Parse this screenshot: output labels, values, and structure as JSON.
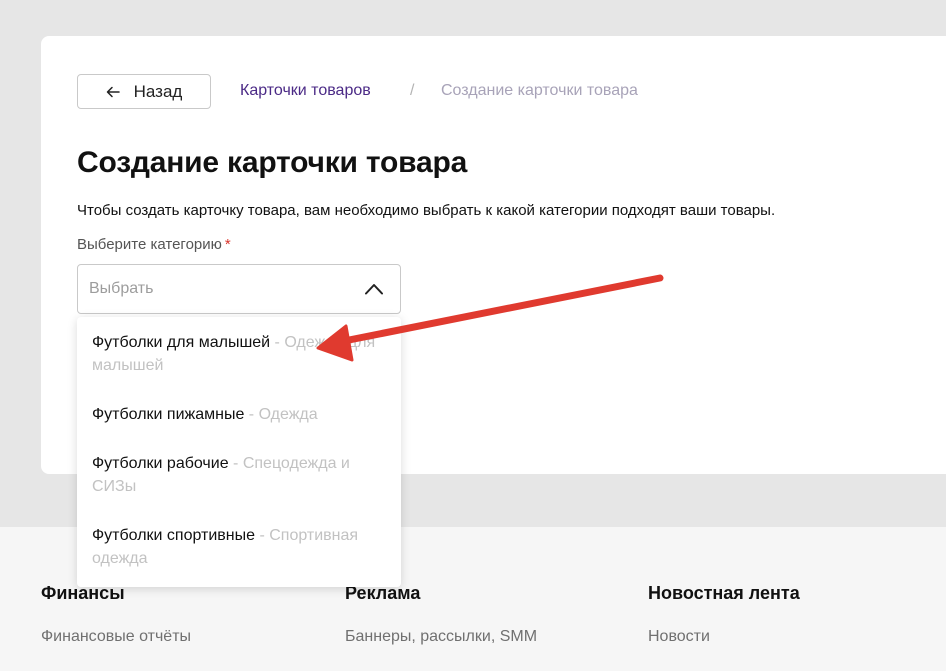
{
  "header": {
    "back_label": "Назад",
    "breadcrumb_link": "Карточки товаров",
    "breadcrumb_separator": "/",
    "breadcrumb_current": "Создание карточки товара"
  },
  "main": {
    "title": "Создание карточки товара",
    "description": "Чтобы создать карточку товара, вам необходимо выбрать к какой категории подходят ваши товары.",
    "category_label": "Выберите категорию",
    "required_mark": "*",
    "select_placeholder": "Выбрать"
  },
  "dropdown": {
    "options": [
      {
        "name": "Футболки для малышей",
        "category": " - Одежда для малышей"
      },
      {
        "name": "Футболки пижамные",
        "category": " - Одежда"
      },
      {
        "name": "Футболки рабочие",
        "category": " - Спецодежда и СИЗы"
      },
      {
        "name": "Футболки спортивные",
        "category": " - Спортивная одежда"
      }
    ]
  },
  "footer": {
    "columns": [
      {
        "heading": "Финансы",
        "link": "Финансовые отчёты"
      },
      {
        "heading": "Реклама",
        "link": "Баннеры, рассылки, SMM"
      },
      {
        "heading": "Новостная лента",
        "link": "Новости"
      }
    ]
  },
  "icons": {
    "back": "arrow-left-icon",
    "select_toggle": "chevron-up-icon",
    "annotation": "red-arrow-annotation"
  },
  "colors": {
    "breadcrumb_link": "#4b2a86",
    "required": "#d9352c",
    "annotation_arrow": "#e03a2f",
    "secondary_text": "#c2c2c2"
  }
}
